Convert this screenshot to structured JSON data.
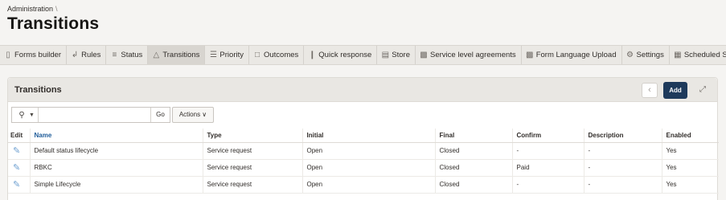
{
  "breadcrumb": {
    "item": "Administration",
    "separator": "\\"
  },
  "page_title": "Transitions",
  "tabs": [
    {
      "label": "Forms builder",
      "icon": "document-icon",
      "active": false
    },
    {
      "label": "Rules",
      "icon": "rules-icon",
      "active": false
    },
    {
      "label": "Status",
      "icon": "status-icon",
      "active": false
    },
    {
      "label": "Transitions",
      "icon": "transitions-icon",
      "active": true
    },
    {
      "label": "Priority",
      "icon": "priority-icon",
      "active": false
    },
    {
      "label": "Outcomes",
      "icon": "outcomes-icon",
      "active": false
    },
    {
      "label": "Quick response",
      "icon": "quick-response-icon",
      "active": false
    },
    {
      "label": "Store",
      "icon": "store-icon",
      "active": false
    },
    {
      "label": "Service level agreements",
      "icon": "sla-icon",
      "active": false
    },
    {
      "label": "Form Language Upload",
      "icon": "upload-icon",
      "active": false
    },
    {
      "label": "Settings",
      "icon": "gear-icon",
      "active": false
    },
    {
      "label": "Scheduled Serv",
      "icon": "calendar-icon",
      "active": false
    }
  ],
  "panel": {
    "title": "Transitions",
    "add_label": "Add",
    "search": {
      "placeholder": "",
      "go_label": "Go"
    },
    "actions_label": "Actions",
    "columns": [
      "Edit",
      "Name",
      "Type",
      "Initial",
      "Final",
      "Confirm",
      "Description",
      "Enabled"
    ],
    "rows": [
      {
        "name": "Default status lifecycle",
        "type": "Service request",
        "initial": "Open",
        "final": "Closed",
        "confirm": "-",
        "description": "-",
        "enabled": "Yes"
      },
      {
        "name": "RBKC",
        "type": "Service request",
        "initial": "Open",
        "final": "Closed",
        "confirm": "Paid",
        "description": "-",
        "enabled": "Yes"
      },
      {
        "name": "Simple Lifecycle",
        "type": "Service request",
        "initial": "Open",
        "final": "Closed",
        "confirm": "-",
        "description": "-",
        "enabled": "Yes"
      }
    ]
  },
  "colors": {
    "primary_button": "#1e3a5b",
    "link": "#1f5c99",
    "edit_icon": "#6d9fd0"
  }
}
